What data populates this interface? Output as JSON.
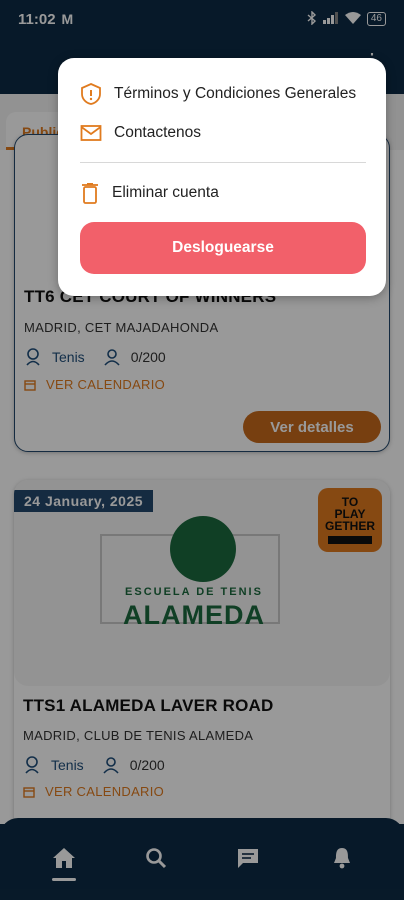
{
  "status_bar": {
    "time": "11:02",
    "gmail_glyph": "M",
    "battery": "46"
  },
  "tabs": {
    "active_label": "Public"
  },
  "events": [
    {
      "title": "TT6 CET COURT OF WINNERS",
      "location": "MADRID, CET MAJADAHONDA",
      "sport": "Tenis",
      "players": "0/200",
      "calendar_label": "VER CALENDARIO",
      "details_label": "Ver detalles"
    },
    {
      "date": "24 January, 2025",
      "organizer_logo_text": "TO PLAY GETHER",
      "club_logo": {
        "school": "ESCUELA DE TENIS",
        "name": "ALAMEDA"
      },
      "title": "TTS1 ALAMEDA LAVER ROAD",
      "location": "MADRID, CLUB DE TENIS ALAMEDA",
      "sport": "Tenis",
      "players": "0/200",
      "calendar_label": "VER CALENDARIO"
    }
  ],
  "menu": {
    "terms_label": "Términos y Condiciones Generales",
    "contact_label": "Contactenos",
    "delete_label": "Eliminar cuenta",
    "logout_label": "Desloguearse"
  },
  "bottom_nav": {
    "items": [
      "home-icon",
      "search-icon",
      "chat-icon",
      "bell-icon"
    ]
  },
  "colors": {
    "primary_navy": "#0d2b45",
    "accent_orange": "#e07b1f",
    "logout_red": "#f2606a"
  }
}
